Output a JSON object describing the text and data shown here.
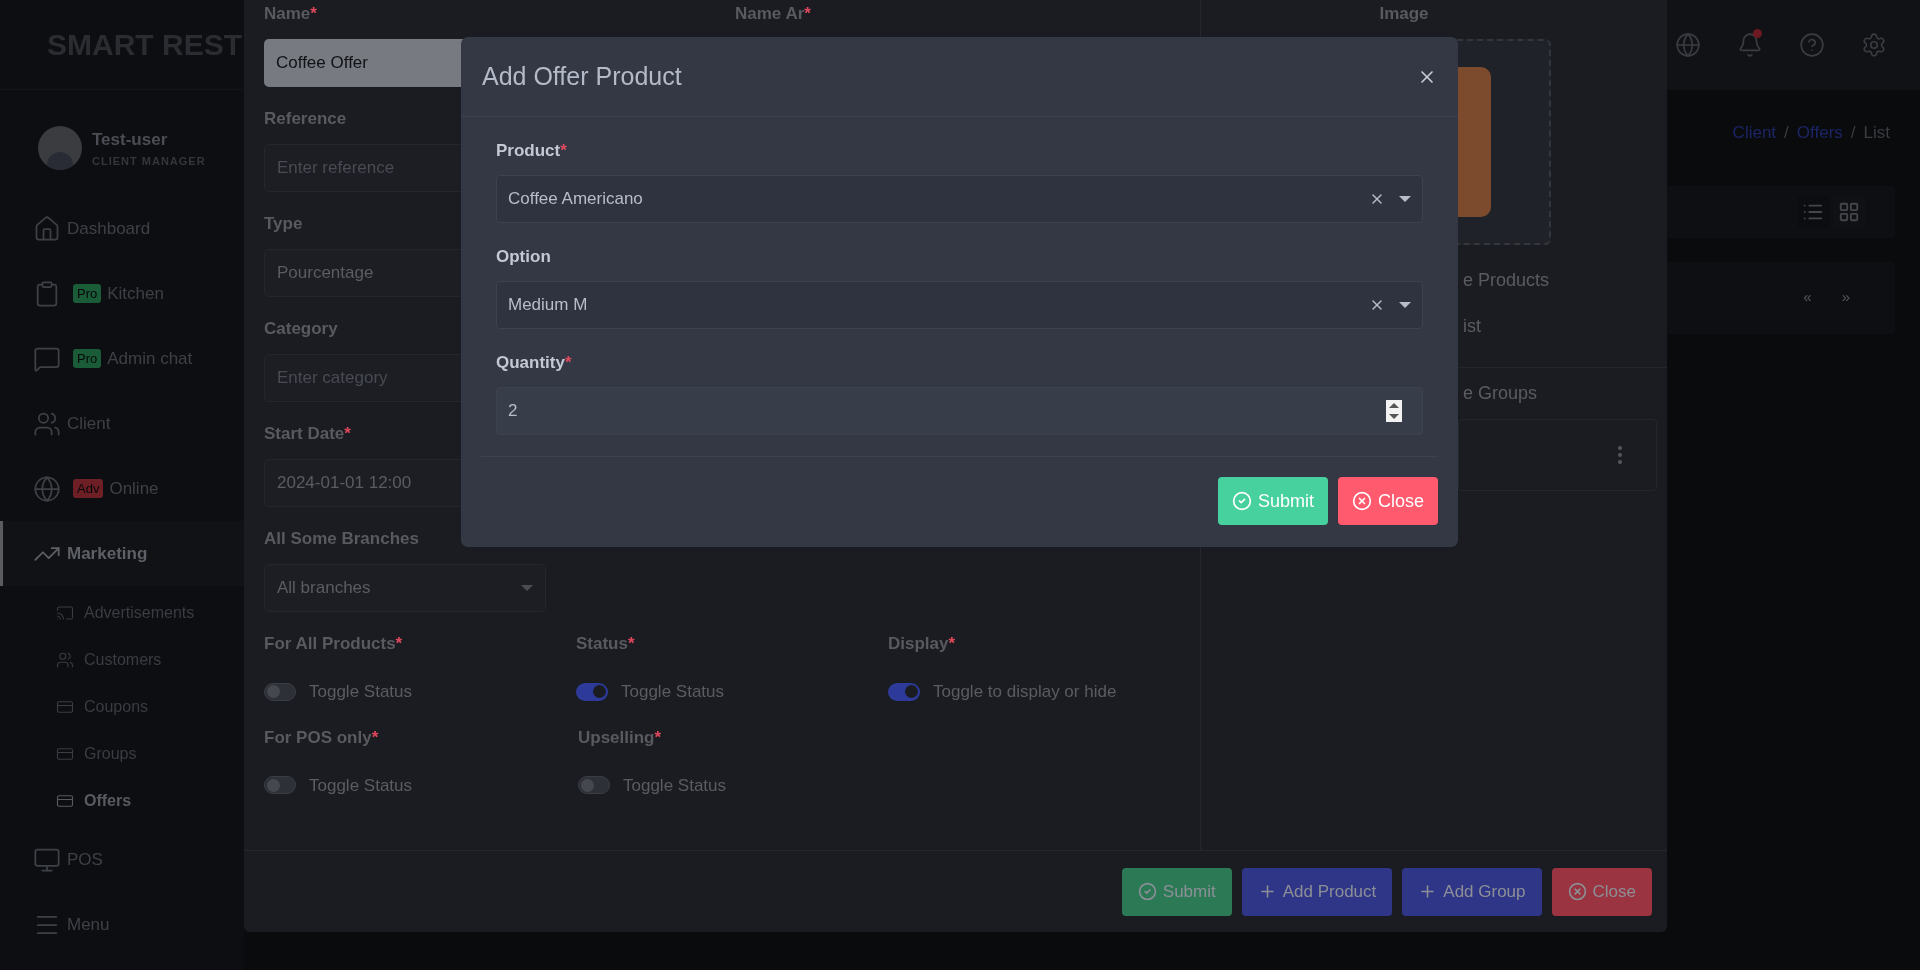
{
  "sidebar": {
    "logo": "SMART REST",
    "user": {
      "name": "Test-user",
      "role": "CLIENT MANAGER"
    },
    "items": [
      {
        "label": "Dashboard",
        "selected": false
      },
      {
        "label": "Kitchen",
        "badge": {
          "text": "Pro",
          "color": "#1b5c38"
        },
        "selected": false
      },
      {
        "label": "Admin chat",
        "badge": {
          "text": "Pro",
          "color": "#1b5c38"
        },
        "selected": false
      },
      {
        "label": "Client",
        "selected": false
      },
      {
        "label": "Online",
        "badge": {
          "text": "Adv",
          "color": "#6e1f26"
        },
        "selected": false
      },
      {
        "label": "Marketing",
        "selected": true,
        "expanded": true,
        "children": [
          {
            "label": "Advertisements",
            "selected": false
          },
          {
            "label": "Customers",
            "selected": false
          },
          {
            "label": "Coupons",
            "selected": false
          },
          {
            "label": "Groups",
            "selected": false
          },
          {
            "label": "Offers",
            "selected": true
          }
        ]
      },
      {
        "label": "POS",
        "selected": false
      },
      {
        "label": "Menu",
        "selected": false
      }
    ]
  },
  "header": {
    "notifications_unread": true
  },
  "breadcrumb": [
    {
      "kind": "link",
      "text": "Client"
    },
    {
      "kind": "separator",
      "text": "/"
    },
    {
      "kind": "link",
      "text": "Offers"
    },
    {
      "kind": "separator",
      "text": "/"
    },
    {
      "kind": "current",
      "text": "List"
    }
  ],
  "pagination": {
    "prev": "«",
    "next": "»"
  },
  "offer_form": {
    "fields": [
      {
        "label": "Name",
        "required_mark": "*",
        "value": "Coffee Offer",
        "kind": "filled"
      },
      {
        "label": "Reference",
        "placeholder": "Enter reference",
        "kind": "text"
      },
      {
        "label": "Type",
        "value": "Pourcentage",
        "kind": "text"
      },
      {
        "label": "Category",
        "placeholder": "Enter category",
        "kind": "text"
      },
      {
        "label": "Start Date",
        "required_mark": "*",
        "value": "2024-01-01 12:00",
        "kind": "text"
      },
      {
        "label": "All Some Branches",
        "value": "All branches",
        "kind": "select"
      }
    ],
    "name_ar_label": {
      "label": "Name Ar",
      "required_mark": "*"
    },
    "toggle_rows": [
      [
        {
          "label": "For All Products",
          "required_mark": "*",
          "text": "Toggle Status",
          "on": false
        },
        {
          "label": "Status",
          "required_mark": "*",
          "text": "Toggle Status",
          "on": true
        },
        {
          "label": "Display",
          "required_mark": "*",
          "text": "Toggle to display or hide",
          "on": true
        }
      ],
      [
        {
          "label": "For POS only",
          "required_mark": "*",
          "text": "Toggle Status",
          "on": false
        },
        {
          "label": "Upselling",
          "required_mark": "*",
          "text": "Toggle Status",
          "on": false
        }
      ]
    ],
    "image_label": "Image",
    "sections": [
      "e Products",
      "ist",
      "e Groups"
    ],
    "buttons": [
      {
        "label": "Submit",
        "kind": "submit"
      },
      {
        "label": "Add Product",
        "kind": "add"
      },
      {
        "label": "Add Group",
        "kind": "add"
      },
      {
        "label": "Close",
        "kind": "close"
      }
    ]
  },
  "product_dialog": {
    "title": "Add Offer Product",
    "fields": [
      {
        "label": "Product",
        "required_mark": "*",
        "value": "Coffee Americano",
        "kind": "select"
      },
      {
        "label": "Option",
        "value": "Medium M",
        "kind": "select"
      },
      {
        "label": "Quantity",
        "required_mark": "*",
        "value": "2",
        "kind": "number"
      }
    ],
    "buttons": [
      {
        "label": "Submit",
        "kind": "submit"
      },
      {
        "label": "Close",
        "kind": "close"
      }
    ]
  }
}
